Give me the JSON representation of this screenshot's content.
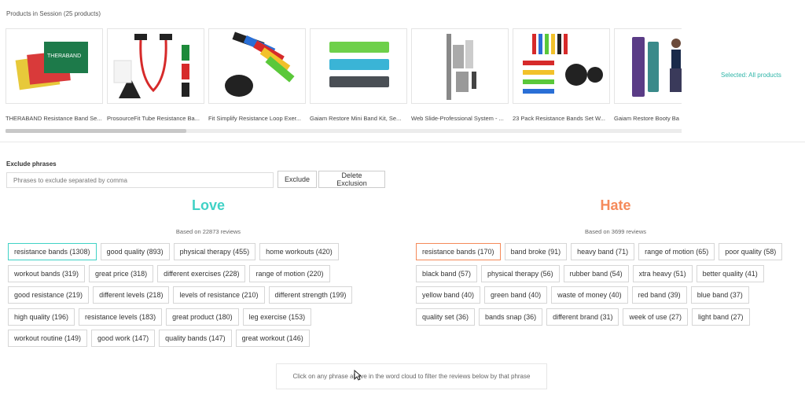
{
  "session": {
    "title": "Products in Session (25 products)"
  },
  "products": [
    {
      "name": "THERABAND Resistance Band Se..."
    },
    {
      "name": "ProsourceFit Tube Resistance Ba..."
    },
    {
      "name": "Fit Simplify Resistance Loop Exer..."
    },
    {
      "name": "Gaiam Restore Mini Band Kit, Se..."
    },
    {
      "name": "Web Slide-Professional System - ..."
    },
    {
      "name": "23 Pack Resistance Bands Set W..."
    },
    {
      "name": "Gaiam Restore Booty Ba"
    }
  ],
  "selection": {
    "text": "Selected: All products"
  },
  "exclude": {
    "label": "Exclude phrases",
    "placeholder": "Phrases to exclude separated by comma",
    "exclude_button": "Exclude",
    "delete_button": "Delete Exclusion"
  },
  "love": {
    "title": "Love",
    "based_on": "Based on 22873 reviews",
    "color": "#40d2c6",
    "rows": [
      [
        "resistance bands (1308)",
        "good quality (893)",
        "physical therapy (455)",
        "home workouts (420)"
      ],
      [
        "workout bands (319)",
        "great price (318)",
        "different exercises (228)",
        "range of motion (220)"
      ],
      [
        "good resistance (219)",
        "different levels (218)",
        "levels of resistance (210)",
        "different strength (199)"
      ],
      [
        "high quality (196)",
        "resistance levels (183)",
        "great product (180)",
        "leg exercise (153)"
      ],
      [
        "workout routine (149)",
        "good work (147)",
        "quality bands (147)",
        "great workout (146)"
      ]
    ]
  },
  "hate": {
    "title": "Hate",
    "based_on": "Based on 3699 reviews",
    "color": "#f58a5a",
    "rows": [
      [
        "resistance bands (170)",
        "band broke (91)",
        "heavy band (71)",
        "range of motion (65)",
        "poor quality (58)"
      ],
      [
        "black band (57)",
        "physical therapy (56)",
        "rubber band (54)",
        "xtra heavy (51)",
        "better quality (41)"
      ],
      [
        "yellow band (40)",
        "green band (40)",
        "waste of money (40)",
        "red band (39)",
        "blue band (37)"
      ],
      [
        "quality set (36)",
        "bands snap (36)",
        "different brand (31)",
        "week of use (27)",
        "light band (27)"
      ]
    ]
  },
  "hint": {
    "text": "Click on any phrase above in the word cloud to filter the reviews below by that phrase"
  }
}
